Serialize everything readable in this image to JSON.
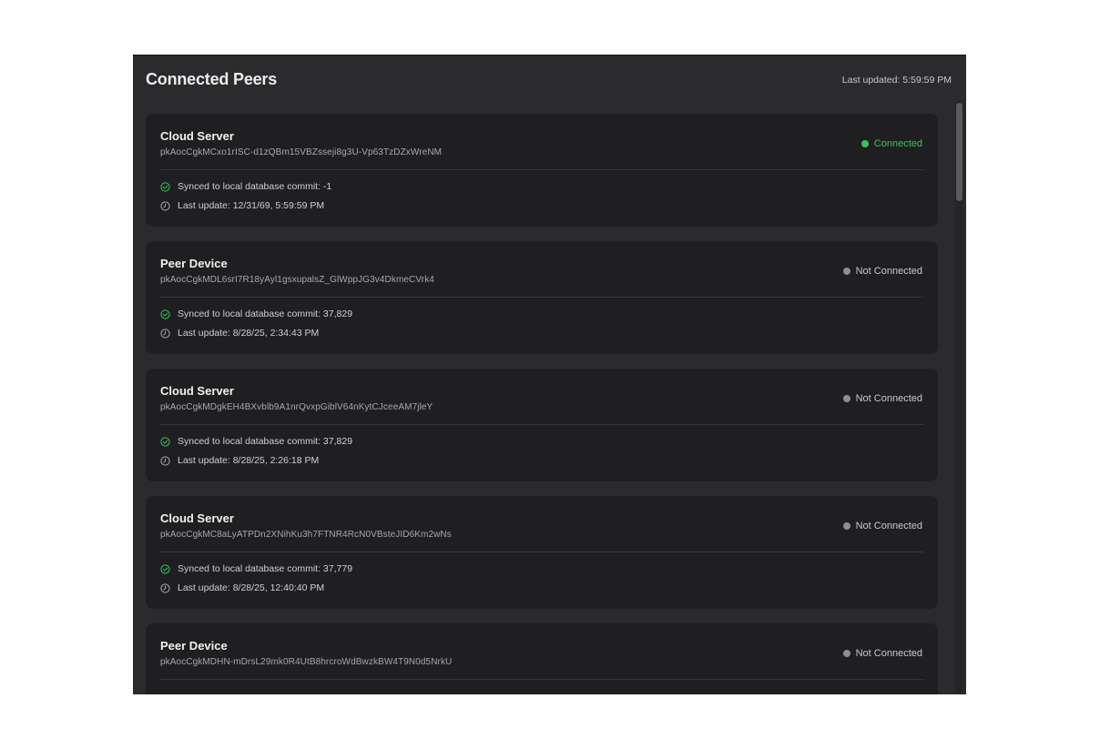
{
  "header": {
    "title": "Connected Peers",
    "last_updated": "Last updated: 5:59:59 PM"
  },
  "colors": {
    "connected": "#32c553",
    "not_connected": "#8e8e93",
    "check_icon": "#32c553",
    "clock_icon": "#a8a8ad"
  },
  "icons": {
    "status": "status-dot-icon",
    "sync": "check-circle-icon",
    "update": "clock-icon"
  },
  "peers": [
    {
      "name": "Cloud Server",
      "key": "pkAocCgkMCxo1rISC-d1zQBm15VBZsseji8g3U-Vp63TzDZxWreNM",
      "status": "Connected",
      "connected": true,
      "sync": "Synced to local database commit: -1",
      "last_update": "Last update: 12/31/69, 5:59:59 PM"
    },
    {
      "name": "Peer Device",
      "key": "pkAocCgkMDL6srI7R18yAyl1gsxupalsZ_GlWppJG3v4DkmeCVrk4",
      "status": "Not Connected",
      "connected": false,
      "sync": "Synced to local database commit: 37,829",
      "last_update": "Last update: 8/28/25, 2:34:43 PM"
    },
    {
      "name": "Cloud Server",
      "key": "pkAocCgkMDgkEH4BXvblb9A1nrQvxpGiblV64nKytCJceeAM7jleY",
      "status": "Not Connected",
      "connected": false,
      "sync": "Synced to local database commit: 37,829",
      "last_update": "Last update: 8/28/25, 2:26:18 PM"
    },
    {
      "name": "Cloud Server",
      "key": "pkAocCgkMC8aLyATPDn2XNihKu3h7FTNR4RcN0VBsteJID6Km2wNs",
      "status": "Not Connected",
      "connected": false,
      "sync": "Synced to local database commit: 37,779",
      "last_update": "Last update: 8/28/25, 12:40:40 PM"
    },
    {
      "name": "Peer Device",
      "key": "pkAocCgkMDHN-mDrsL29mk0R4UtB8hrcroWdBwzkBW4T9N0d5NrkU",
      "status": "Not Connected",
      "connected": false,
      "sync": "",
      "last_update": ""
    }
  ]
}
